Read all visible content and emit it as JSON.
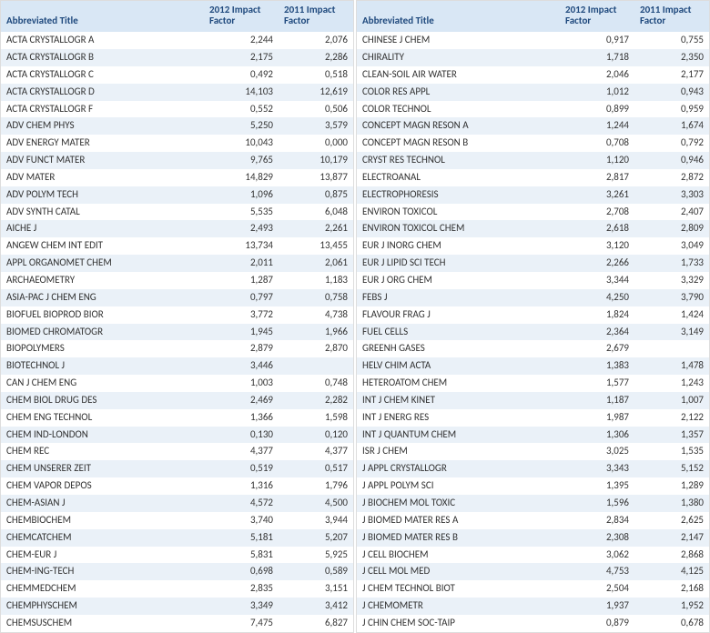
{
  "headers": {
    "title": "Abbreviated Title",
    "y2012": "2012 Impact\nFactor",
    "y2011": "2011 Impact\nFactor"
  },
  "left": [
    {
      "title": "ACTA CRYSTALLOGR A",
      "y2012": "2,244",
      "y2011": "2,076"
    },
    {
      "title": "ACTA CRYSTALLOGR B",
      "y2012": "2,175",
      "y2011": "2,286"
    },
    {
      "title": "ACTA CRYSTALLOGR C",
      "y2012": "0,492",
      "y2011": "0,518"
    },
    {
      "title": "ACTA CRYSTALLOGR D",
      "y2012": "14,103",
      "y2011": "12,619"
    },
    {
      "title": "ACTA CRYSTALLOGR F",
      "y2012": "0,552",
      "y2011": "0,506"
    },
    {
      "title": "ADV CHEM PHYS",
      "y2012": "5,250",
      "y2011": "3,579"
    },
    {
      "title": "ADV ENERGY MATER",
      "y2012": "10,043",
      "y2011": "0,000"
    },
    {
      "title": "ADV FUNCT MATER",
      "y2012": "9,765",
      "y2011": "10,179"
    },
    {
      "title": "ADV MATER",
      "y2012": "14,829",
      "y2011": "13,877"
    },
    {
      "title": "ADV POLYM TECH",
      "y2012": "1,096",
      "y2011": "0,875"
    },
    {
      "title": "ADV SYNTH CATAL",
      "y2012": "5,535",
      "y2011": "6,048"
    },
    {
      "title": "AICHE J",
      "y2012": "2,493",
      "y2011": "2,261"
    },
    {
      "title": "ANGEW CHEM INT EDIT",
      "y2012": "13,734",
      "y2011": "13,455"
    },
    {
      "title": "APPL ORGANOMET CHEM",
      "y2012": "2,011",
      "y2011": "2,061"
    },
    {
      "title": "ARCHAEOMETRY",
      "y2012": "1,287",
      "y2011": "1,183"
    },
    {
      "title": "ASIA-PAC J CHEM ENG",
      "y2012": "0,797",
      "y2011": "0,758"
    },
    {
      "title": "BIOFUEL BIOPROD BIOR",
      "y2012": "3,772",
      "y2011": "4,738"
    },
    {
      "title": "BIOMED CHROMATOGR",
      "y2012": "1,945",
      "y2011": "1,966"
    },
    {
      "title": "BIOPOLYMERS",
      "y2012": "2,879",
      "y2011": "2,870"
    },
    {
      "title": "BIOTECHNOL J",
      "y2012": "3,446",
      "y2011": ""
    },
    {
      "title": "CAN J CHEM ENG",
      "y2012": "1,003",
      "y2011": "0,748"
    },
    {
      "title": "CHEM BIOL DRUG DES",
      "y2012": "2,469",
      "y2011": "2,282"
    },
    {
      "title": "CHEM ENG TECHNOL",
      "y2012": "1,366",
      "y2011": "1,598"
    },
    {
      "title": "CHEM IND-LONDON",
      "y2012": "0,130",
      "y2011": "0,120"
    },
    {
      "title": "CHEM REC",
      "y2012": "4,377",
      "y2011": "4,377"
    },
    {
      "title": "CHEM UNSERER ZEIT",
      "y2012": "0,519",
      "y2011": "0,517"
    },
    {
      "title": "CHEM VAPOR DEPOS",
      "y2012": "1,316",
      "y2011": "1,796"
    },
    {
      "title": "CHEM-ASIAN J",
      "y2012": "4,572",
      "y2011": "4,500"
    },
    {
      "title": "CHEMBIOCHEM",
      "y2012": "3,740",
      "y2011": "3,944"
    },
    {
      "title": "CHEMCATCHEM",
      "y2012": "5,181",
      "y2011": "5,207"
    },
    {
      "title": "CHEM-EUR J",
      "y2012": "5,831",
      "y2011": "5,925"
    },
    {
      "title": "CHEM-ING-TECH",
      "y2012": "0,698",
      "y2011": "0,589"
    },
    {
      "title": "CHEMMEDCHEM",
      "y2012": "2,835",
      "y2011": "3,151"
    },
    {
      "title": "CHEMPHYSCHEM",
      "y2012": "3,349",
      "y2011": "3,412"
    },
    {
      "title": "CHEMSUSCHEM",
      "y2012": "7,475",
      "y2011": "6,827"
    }
  ],
  "right": [
    {
      "title": "CHINESE J CHEM",
      "y2012": "0,917",
      "y2011": "0,755"
    },
    {
      "title": "CHIRALITY",
      "y2012": "1,718",
      "y2011": "2,350"
    },
    {
      "title": "CLEAN-SOIL AIR WATER",
      "y2012": "2,046",
      "y2011": "2,177"
    },
    {
      "title": "COLOR RES APPL",
      "y2012": "1,012",
      "y2011": "0,943"
    },
    {
      "title": "COLOR TECHNOL",
      "y2012": "0,899",
      "y2011": "0,959"
    },
    {
      "title": "CONCEPT MAGN RESON A",
      "y2012": "1,244",
      "y2011": "1,674"
    },
    {
      "title": "CONCEPT MAGN RESON B",
      "y2012": "0,708",
      "y2011": "0,792"
    },
    {
      "title": "CRYST RES TECHNOL",
      "y2012": "1,120",
      "y2011": "0,946"
    },
    {
      "title": "ELECTROANAL",
      "y2012": "2,817",
      "y2011": "2,872"
    },
    {
      "title": "ELECTROPHORESIS",
      "y2012": "3,261",
      "y2011": "3,303"
    },
    {
      "title": "ENVIRON TOXICOL",
      "y2012": "2,708",
      "y2011": "2,407"
    },
    {
      "title": "ENVIRON TOXICOL CHEM",
      "y2012": "2,618",
      "y2011": "2,809"
    },
    {
      "title": "EUR J INORG CHEM",
      "y2012": "3,120",
      "y2011": "3,049"
    },
    {
      "title": "EUR J LIPID SCI TECH",
      "y2012": "2,266",
      "y2011": "1,733"
    },
    {
      "title": "EUR J ORG CHEM",
      "y2012": "3,344",
      "y2011": "3,329"
    },
    {
      "title": "FEBS J",
      "y2012": "4,250",
      "y2011": "3,790"
    },
    {
      "title": "FLAVOUR FRAG J",
      "y2012": "1,824",
      "y2011": "1,424"
    },
    {
      "title": "FUEL CELLS",
      "y2012": "2,364",
      "y2011": "3,149"
    },
    {
      "title": "GREENH GASES",
      "y2012": "2,679",
      "y2011": ""
    },
    {
      "title": "HELV CHIM ACTA",
      "y2012": "1,383",
      "y2011": "1,478"
    },
    {
      "title": "HETEROATOM CHEM",
      "y2012": "1,577",
      "y2011": "1,243"
    },
    {
      "title": "INT J CHEM KINET",
      "y2012": "1,187",
      "y2011": "1,007"
    },
    {
      "title": "INT J ENERG RES",
      "y2012": "1,987",
      "y2011": "2,122"
    },
    {
      "title": "INT J QUANTUM CHEM",
      "y2012": "1,306",
      "y2011": "1,357"
    },
    {
      "title": "ISR J CHEM",
      "y2012": "3,025",
      "y2011": "1,535"
    },
    {
      "title": "J APPL CRYSTALLOGR",
      "y2012": "3,343",
      "y2011": "5,152"
    },
    {
      "title": "J APPL POLYM SCI",
      "y2012": "1,395",
      "y2011": "1,289"
    },
    {
      "title": "J BIOCHEM MOL TOXIC",
      "y2012": "1,596",
      "y2011": "1,380"
    },
    {
      "title": "J BIOMED MATER RES A",
      "y2012": "2,834",
      "y2011": "2,625"
    },
    {
      "title": "J BIOMED MATER RES B",
      "y2012": "2,308",
      "y2011": "2,147"
    },
    {
      "title": "J CELL BIOCHEM",
      "y2012": "3,062",
      "y2011": "2,868"
    },
    {
      "title": "J CELL MOL MED",
      "y2012": "4,753",
      "y2011": "4,125"
    },
    {
      "title": "J CHEM TECHNOL BIOT",
      "y2012": "2,504",
      "y2011": "2,168"
    },
    {
      "title": "J CHEMOMETR",
      "y2012": "1,937",
      "y2011": "1,952"
    },
    {
      "title": "J CHIN CHEM SOC-TAIP",
      "y2012": "0,879",
      "y2011": "0,678"
    }
  ]
}
